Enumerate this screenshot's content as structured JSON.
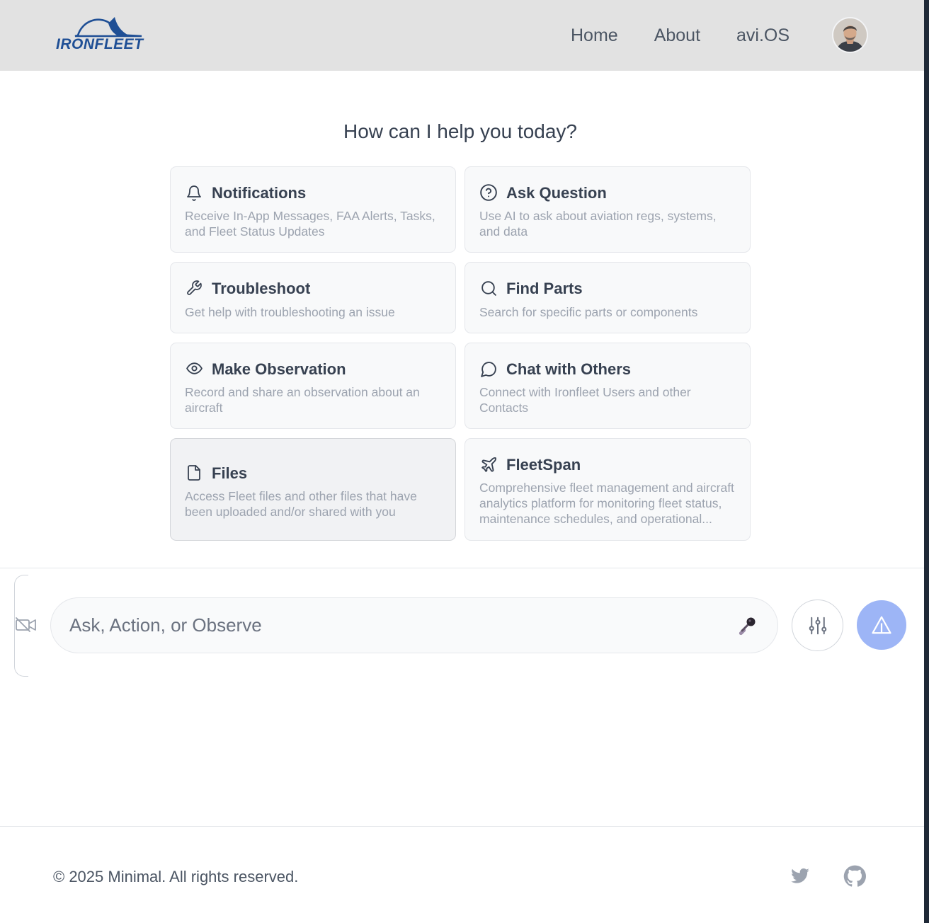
{
  "header": {
    "logo_text": "IRONFLEET",
    "nav": [
      {
        "label": "Home"
      },
      {
        "label": "About"
      },
      {
        "label": "avi.OS"
      }
    ],
    "avatar_icon": "user-avatar"
  },
  "main": {
    "prompt": "How can I help you today?",
    "cards": [
      {
        "title": "Notifications",
        "description": "Receive In-App Messages, FAA Alerts, Tasks, and Fleet Status Updates",
        "icon": "bell-icon"
      },
      {
        "title": "Ask Question",
        "description": "Use AI to ask about aviation regs, systems, and data",
        "icon": "question-circle-icon"
      },
      {
        "title": "Troubleshoot",
        "description": "Get help with troubleshooting an issue",
        "icon": "wrench-icon"
      },
      {
        "title": "Find Parts",
        "description": "Search for specific parts or components",
        "icon": "search-icon"
      },
      {
        "title": "Make Observation",
        "description": "Record and share an observation about an aircraft",
        "icon": "eye-icon"
      },
      {
        "title": "Chat with Others",
        "description": "Connect with Ironfleet Users and other Contacts",
        "icon": "chat-bubble-icon"
      },
      {
        "title": "Files",
        "description": "Access Fleet files and other files that have been uploaded and/or shared with you",
        "icon": "file-icon"
      },
      {
        "title": "FleetSpan",
        "description": "Comprehensive fleet management and aircraft analytics platform for monitoring fleet status, maintenance schedules, and operational...",
        "icon": "plane-icon"
      }
    ]
  },
  "chat": {
    "placeholder": "Ask, Action, or Observe",
    "value": "",
    "icons": {
      "camera": "video-off-icon",
      "mic": "microphone-icon",
      "settings": "sliders-icon",
      "send": "send-icon"
    },
    "send_color": "#9db5f6"
  },
  "footer": {
    "copyright": "© 2025 Minimal. All rights reserved.",
    "social": [
      "twitter-icon",
      "github-icon"
    ]
  },
  "colors": {
    "brand": "#1f4f95",
    "header_bg": "#e2e2e2",
    "card_bg": "#f8f9fa"
  }
}
